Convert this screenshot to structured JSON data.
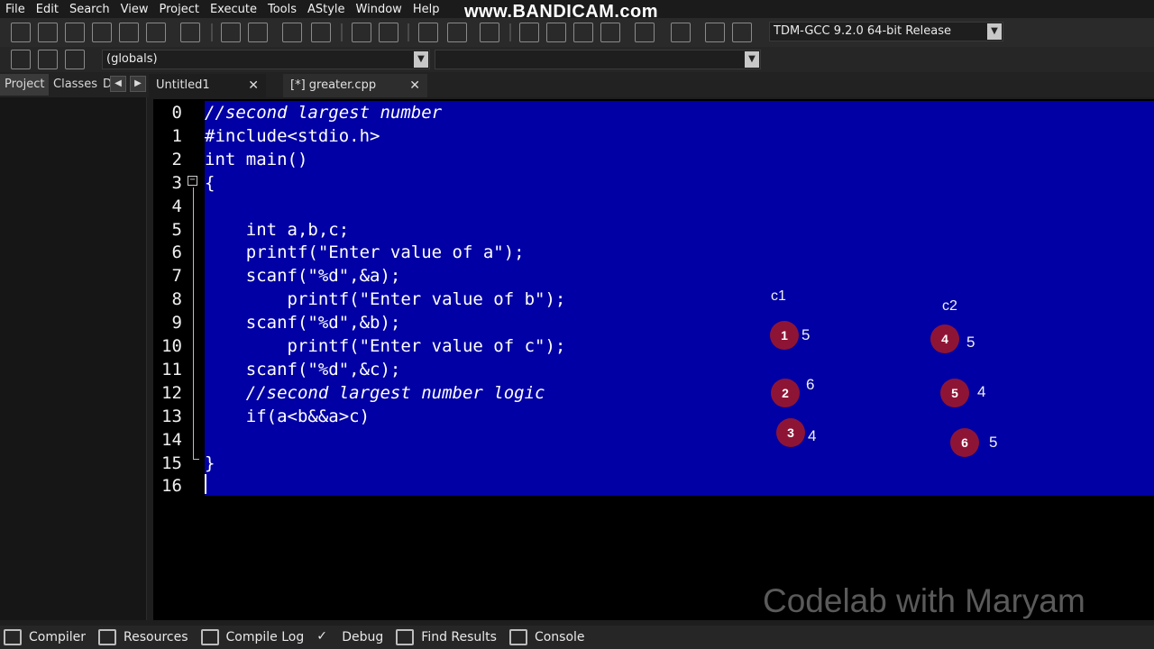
{
  "menu": [
    "File",
    "Edit",
    "Search",
    "View",
    "Project",
    "Execute",
    "Tools",
    "AStyle",
    "Window",
    "Help"
  ],
  "watermark": "www.BANDICAM.com",
  "compiler": "TDM-GCC 9.2.0 64-bit Release",
  "scope": "(globals)",
  "left_tabs": [
    "Project",
    "Classes",
    "D"
  ],
  "file_tabs": [
    {
      "label": "Untitled1"
    },
    {
      "label": "[*] greater.cpp"
    }
  ],
  "lines": [
    {
      "n": "0",
      "text": "//second largest number",
      "comment": true
    },
    {
      "n": "1",
      "text": "#include<stdio.h>"
    },
    {
      "n": "2",
      "text": "int main()"
    },
    {
      "n": "3",
      "text": "{"
    },
    {
      "n": "4",
      "text": ""
    },
    {
      "n": "5",
      "text": "    int a,b,c;"
    },
    {
      "n": "6",
      "text": "    printf(\"Enter value of a\");"
    },
    {
      "n": "7",
      "text": "    scanf(\"%d\",&a);"
    },
    {
      "n": "8",
      "text": "        printf(\"Enter value of b\");"
    },
    {
      "n": "9",
      "text": "    scanf(\"%d\",&b);"
    },
    {
      "n": "10",
      "text": "        printf(\"Enter value of c\");"
    },
    {
      "n": "11",
      "text": "    scanf(\"%d\",&c);"
    },
    {
      "n": "12",
      "text": "    //second largest number logic",
      "comment": true
    },
    {
      "n": "13",
      "text": "    if(a<b&&a>c)"
    },
    {
      "n": "14",
      "text": ""
    },
    {
      "n": "15",
      "text": "}"
    },
    {
      "n": "16",
      "text": ""
    }
  ],
  "annotations": {
    "c1_label": "c1",
    "c2_label": "c2",
    "items": [
      {
        "num": "1",
        "value": "5"
      },
      {
        "num": "2",
        "value": "6"
      },
      {
        "num": "3",
        "value": "4"
      },
      {
        "num": "4",
        "value": "5"
      },
      {
        "num": "5",
        "value": "4"
      },
      {
        "num": "6",
        "value": "5"
      }
    ]
  },
  "brand": "Codelab with Maryam",
  "bottom_tabs": [
    "Compiler",
    "Resources",
    "Compile Log",
    "Debug",
    "Find Results",
    "Console"
  ],
  "colors": {
    "selection": "#0000a4",
    "marker": "#8e1436"
  }
}
